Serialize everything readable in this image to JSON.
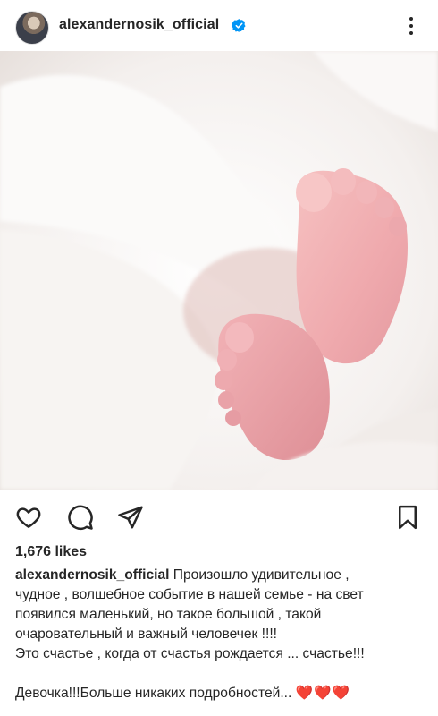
{
  "post": {
    "username": "alexandernosik_official",
    "verified": true,
    "likes": "1,676 likes",
    "image_alt": "Baby feet in a white blanket",
    "caption": {
      "username": "alexandernosik_official",
      "line1": " Произошло удивительное ,",
      "line2": "чудное , волшебное событие в нашей семье - на свет",
      "line3": "появился маленький, но такое большой , такой",
      "line4": "очаровательный и важный человечек !!!!",
      "line5": "Это счастье , когда от счастья рождается ... счастье!!!",
      "line6": "Девочка!!!Больше никаких подробностей...",
      "hearts": "❤️❤️❤️"
    }
  },
  "icons": {
    "avatar": "avatar",
    "verified": "verified-badge-icon",
    "more": "more-options-icon",
    "like": "heart-icon",
    "comment": "comment-icon",
    "share": "send-icon",
    "save": "bookmark-icon"
  },
  "colors": {
    "text": "#262626",
    "verified": "#0095f6",
    "hearts": "#e0245e"
  }
}
